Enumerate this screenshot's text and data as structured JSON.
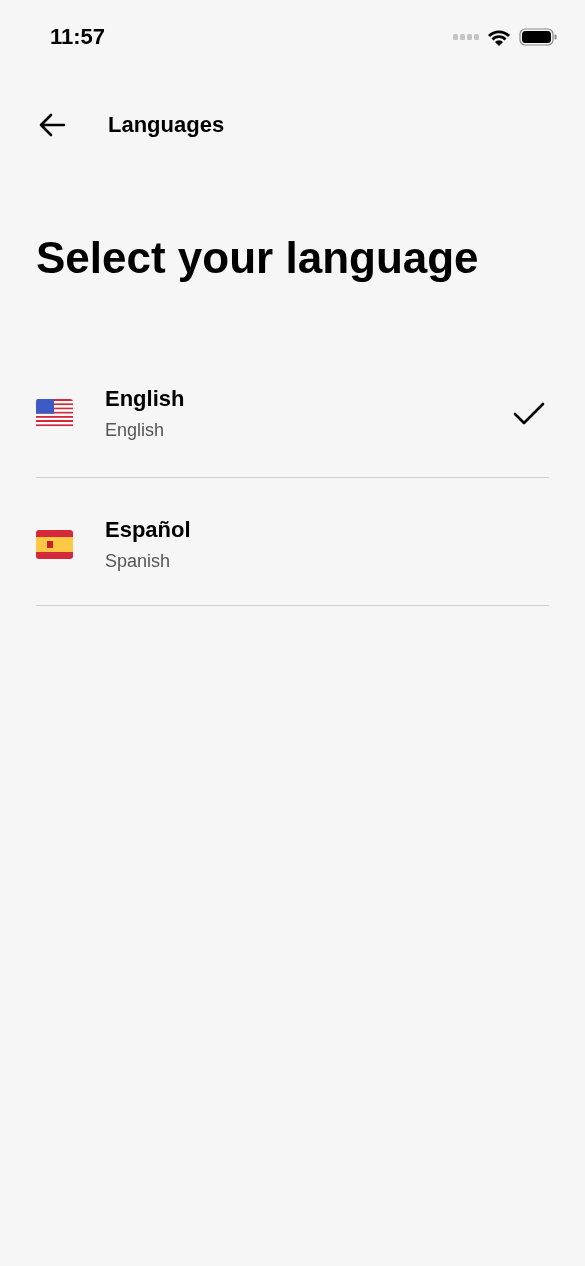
{
  "status_bar": {
    "time": "11:57"
  },
  "nav": {
    "title": "Languages"
  },
  "heading": "Select your language",
  "languages": [
    {
      "kind": "us",
      "name": "English",
      "subtitle": "English",
      "selected": true
    },
    {
      "kind": "es",
      "name": "Español",
      "subtitle": "Spanish",
      "selected": false
    }
  ]
}
